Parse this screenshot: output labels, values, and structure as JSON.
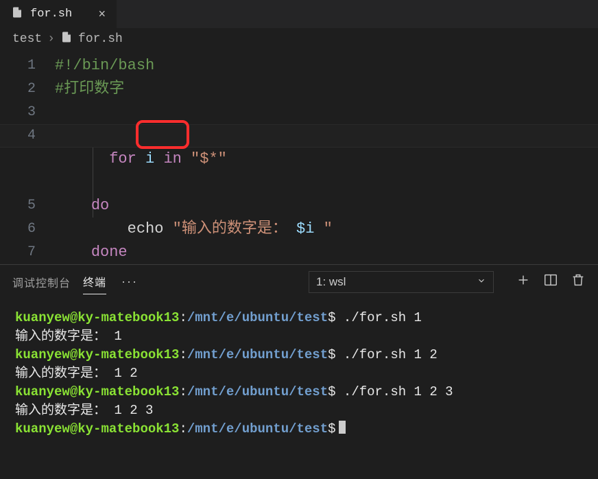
{
  "tab": {
    "filename": "for.sh"
  },
  "breadcrumb": {
    "folder": "test",
    "file": "for.sh"
  },
  "code": {
    "line1": "#!/bin/bash",
    "line2": "#打印数字",
    "line4_for": "for",
    "line4_i": " i ",
    "line4_in": "in",
    "line4_sp": " ",
    "line4_str": "\"$*\"",
    "line5": "do",
    "line6_echo": "echo ",
    "line6_str1": "\"输入的数字是： ",
    "line6_var": "$i",
    "line6_str2": " \"",
    "line7": "done"
  },
  "gutter": [
    "1",
    "2",
    "3",
    "4",
    "5",
    "6",
    "7"
  ],
  "panel": {
    "tab_debug": "调试控制台",
    "tab_terminal": "终端",
    "selector": "1: wsl"
  },
  "term": {
    "user": "kuanyew",
    "at": "@",
    "host": "ky-matebook13",
    "colon": ":",
    "path": "/mnt/e/ubuntu/test",
    "dollar": "$",
    "runs": [
      {
        "cmd": " ./for.sh 1",
        "out": "输入的数字是：  1"
      },
      {
        "cmd": " ./for.sh 1 2",
        "out": "输入的数字是：  1 2"
      },
      {
        "cmd": " ./for.sh 1 2 3",
        "out": "输入的数字是：  1 2 3"
      }
    ]
  }
}
